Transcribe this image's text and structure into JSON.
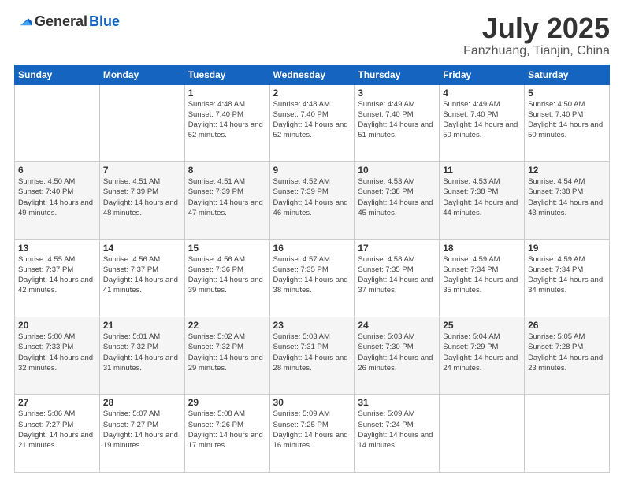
{
  "logo": {
    "text_general": "General",
    "text_blue": "Blue"
  },
  "header": {
    "month": "July 2025",
    "location": "Fanzhuang, Tianjin, China"
  },
  "weekdays": [
    "Sunday",
    "Monday",
    "Tuesday",
    "Wednesday",
    "Thursday",
    "Friday",
    "Saturday"
  ],
  "weeks": [
    [
      {
        "day": "",
        "sunrise": "",
        "sunset": "",
        "daylight": ""
      },
      {
        "day": "",
        "sunrise": "",
        "sunset": "",
        "daylight": ""
      },
      {
        "day": "1",
        "sunrise": "Sunrise: 4:48 AM",
        "sunset": "Sunset: 7:40 PM",
        "daylight": "Daylight: 14 hours and 52 minutes."
      },
      {
        "day": "2",
        "sunrise": "Sunrise: 4:48 AM",
        "sunset": "Sunset: 7:40 PM",
        "daylight": "Daylight: 14 hours and 52 minutes."
      },
      {
        "day": "3",
        "sunrise": "Sunrise: 4:49 AM",
        "sunset": "Sunset: 7:40 PM",
        "daylight": "Daylight: 14 hours and 51 minutes."
      },
      {
        "day": "4",
        "sunrise": "Sunrise: 4:49 AM",
        "sunset": "Sunset: 7:40 PM",
        "daylight": "Daylight: 14 hours and 50 minutes."
      },
      {
        "day": "5",
        "sunrise": "Sunrise: 4:50 AM",
        "sunset": "Sunset: 7:40 PM",
        "daylight": "Daylight: 14 hours and 50 minutes."
      }
    ],
    [
      {
        "day": "6",
        "sunrise": "Sunrise: 4:50 AM",
        "sunset": "Sunset: 7:40 PM",
        "daylight": "Daylight: 14 hours and 49 minutes."
      },
      {
        "day": "7",
        "sunrise": "Sunrise: 4:51 AM",
        "sunset": "Sunset: 7:39 PM",
        "daylight": "Daylight: 14 hours and 48 minutes."
      },
      {
        "day": "8",
        "sunrise": "Sunrise: 4:51 AM",
        "sunset": "Sunset: 7:39 PM",
        "daylight": "Daylight: 14 hours and 47 minutes."
      },
      {
        "day": "9",
        "sunrise": "Sunrise: 4:52 AM",
        "sunset": "Sunset: 7:39 PM",
        "daylight": "Daylight: 14 hours and 46 minutes."
      },
      {
        "day": "10",
        "sunrise": "Sunrise: 4:53 AM",
        "sunset": "Sunset: 7:38 PM",
        "daylight": "Daylight: 14 hours and 45 minutes."
      },
      {
        "day": "11",
        "sunrise": "Sunrise: 4:53 AM",
        "sunset": "Sunset: 7:38 PM",
        "daylight": "Daylight: 14 hours and 44 minutes."
      },
      {
        "day": "12",
        "sunrise": "Sunrise: 4:54 AM",
        "sunset": "Sunset: 7:38 PM",
        "daylight": "Daylight: 14 hours and 43 minutes."
      }
    ],
    [
      {
        "day": "13",
        "sunrise": "Sunrise: 4:55 AM",
        "sunset": "Sunset: 7:37 PM",
        "daylight": "Daylight: 14 hours and 42 minutes."
      },
      {
        "day": "14",
        "sunrise": "Sunrise: 4:56 AM",
        "sunset": "Sunset: 7:37 PM",
        "daylight": "Daylight: 14 hours and 41 minutes."
      },
      {
        "day": "15",
        "sunrise": "Sunrise: 4:56 AM",
        "sunset": "Sunset: 7:36 PM",
        "daylight": "Daylight: 14 hours and 39 minutes."
      },
      {
        "day": "16",
        "sunrise": "Sunrise: 4:57 AM",
        "sunset": "Sunset: 7:35 PM",
        "daylight": "Daylight: 14 hours and 38 minutes."
      },
      {
        "day": "17",
        "sunrise": "Sunrise: 4:58 AM",
        "sunset": "Sunset: 7:35 PM",
        "daylight": "Daylight: 14 hours and 37 minutes."
      },
      {
        "day": "18",
        "sunrise": "Sunrise: 4:59 AM",
        "sunset": "Sunset: 7:34 PM",
        "daylight": "Daylight: 14 hours and 35 minutes."
      },
      {
        "day": "19",
        "sunrise": "Sunrise: 4:59 AM",
        "sunset": "Sunset: 7:34 PM",
        "daylight": "Daylight: 14 hours and 34 minutes."
      }
    ],
    [
      {
        "day": "20",
        "sunrise": "Sunrise: 5:00 AM",
        "sunset": "Sunset: 7:33 PM",
        "daylight": "Daylight: 14 hours and 32 minutes."
      },
      {
        "day": "21",
        "sunrise": "Sunrise: 5:01 AM",
        "sunset": "Sunset: 7:32 PM",
        "daylight": "Daylight: 14 hours and 31 minutes."
      },
      {
        "day": "22",
        "sunrise": "Sunrise: 5:02 AM",
        "sunset": "Sunset: 7:32 PM",
        "daylight": "Daylight: 14 hours and 29 minutes."
      },
      {
        "day": "23",
        "sunrise": "Sunrise: 5:03 AM",
        "sunset": "Sunset: 7:31 PM",
        "daylight": "Daylight: 14 hours and 28 minutes."
      },
      {
        "day": "24",
        "sunrise": "Sunrise: 5:03 AM",
        "sunset": "Sunset: 7:30 PM",
        "daylight": "Daylight: 14 hours and 26 minutes."
      },
      {
        "day": "25",
        "sunrise": "Sunrise: 5:04 AM",
        "sunset": "Sunset: 7:29 PM",
        "daylight": "Daylight: 14 hours and 24 minutes."
      },
      {
        "day": "26",
        "sunrise": "Sunrise: 5:05 AM",
        "sunset": "Sunset: 7:28 PM",
        "daylight": "Daylight: 14 hours and 23 minutes."
      }
    ],
    [
      {
        "day": "27",
        "sunrise": "Sunrise: 5:06 AM",
        "sunset": "Sunset: 7:27 PM",
        "daylight": "Daylight: 14 hours and 21 minutes."
      },
      {
        "day": "28",
        "sunrise": "Sunrise: 5:07 AM",
        "sunset": "Sunset: 7:27 PM",
        "daylight": "Daylight: 14 hours and 19 minutes."
      },
      {
        "day": "29",
        "sunrise": "Sunrise: 5:08 AM",
        "sunset": "Sunset: 7:26 PM",
        "daylight": "Daylight: 14 hours and 17 minutes."
      },
      {
        "day": "30",
        "sunrise": "Sunrise: 5:09 AM",
        "sunset": "Sunset: 7:25 PM",
        "daylight": "Daylight: 14 hours and 16 minutes."
      },
      {
        "day": "31",
        "sunrise": "Sunrise: 5:09 AM",
        "sunset": "Sunset: 7:24 PM",
        "daylight": "Daylight: 14 hours and 14 minutes."
      },
      {
        "day": "",
        "sunrise": "",
        "sunset": "",
        "daylight": ""
      },
      {
        "day": "",
        "sunrise": "",
        "sunset": "",
        "daylight": ""
      }
    ]
  ]
}
